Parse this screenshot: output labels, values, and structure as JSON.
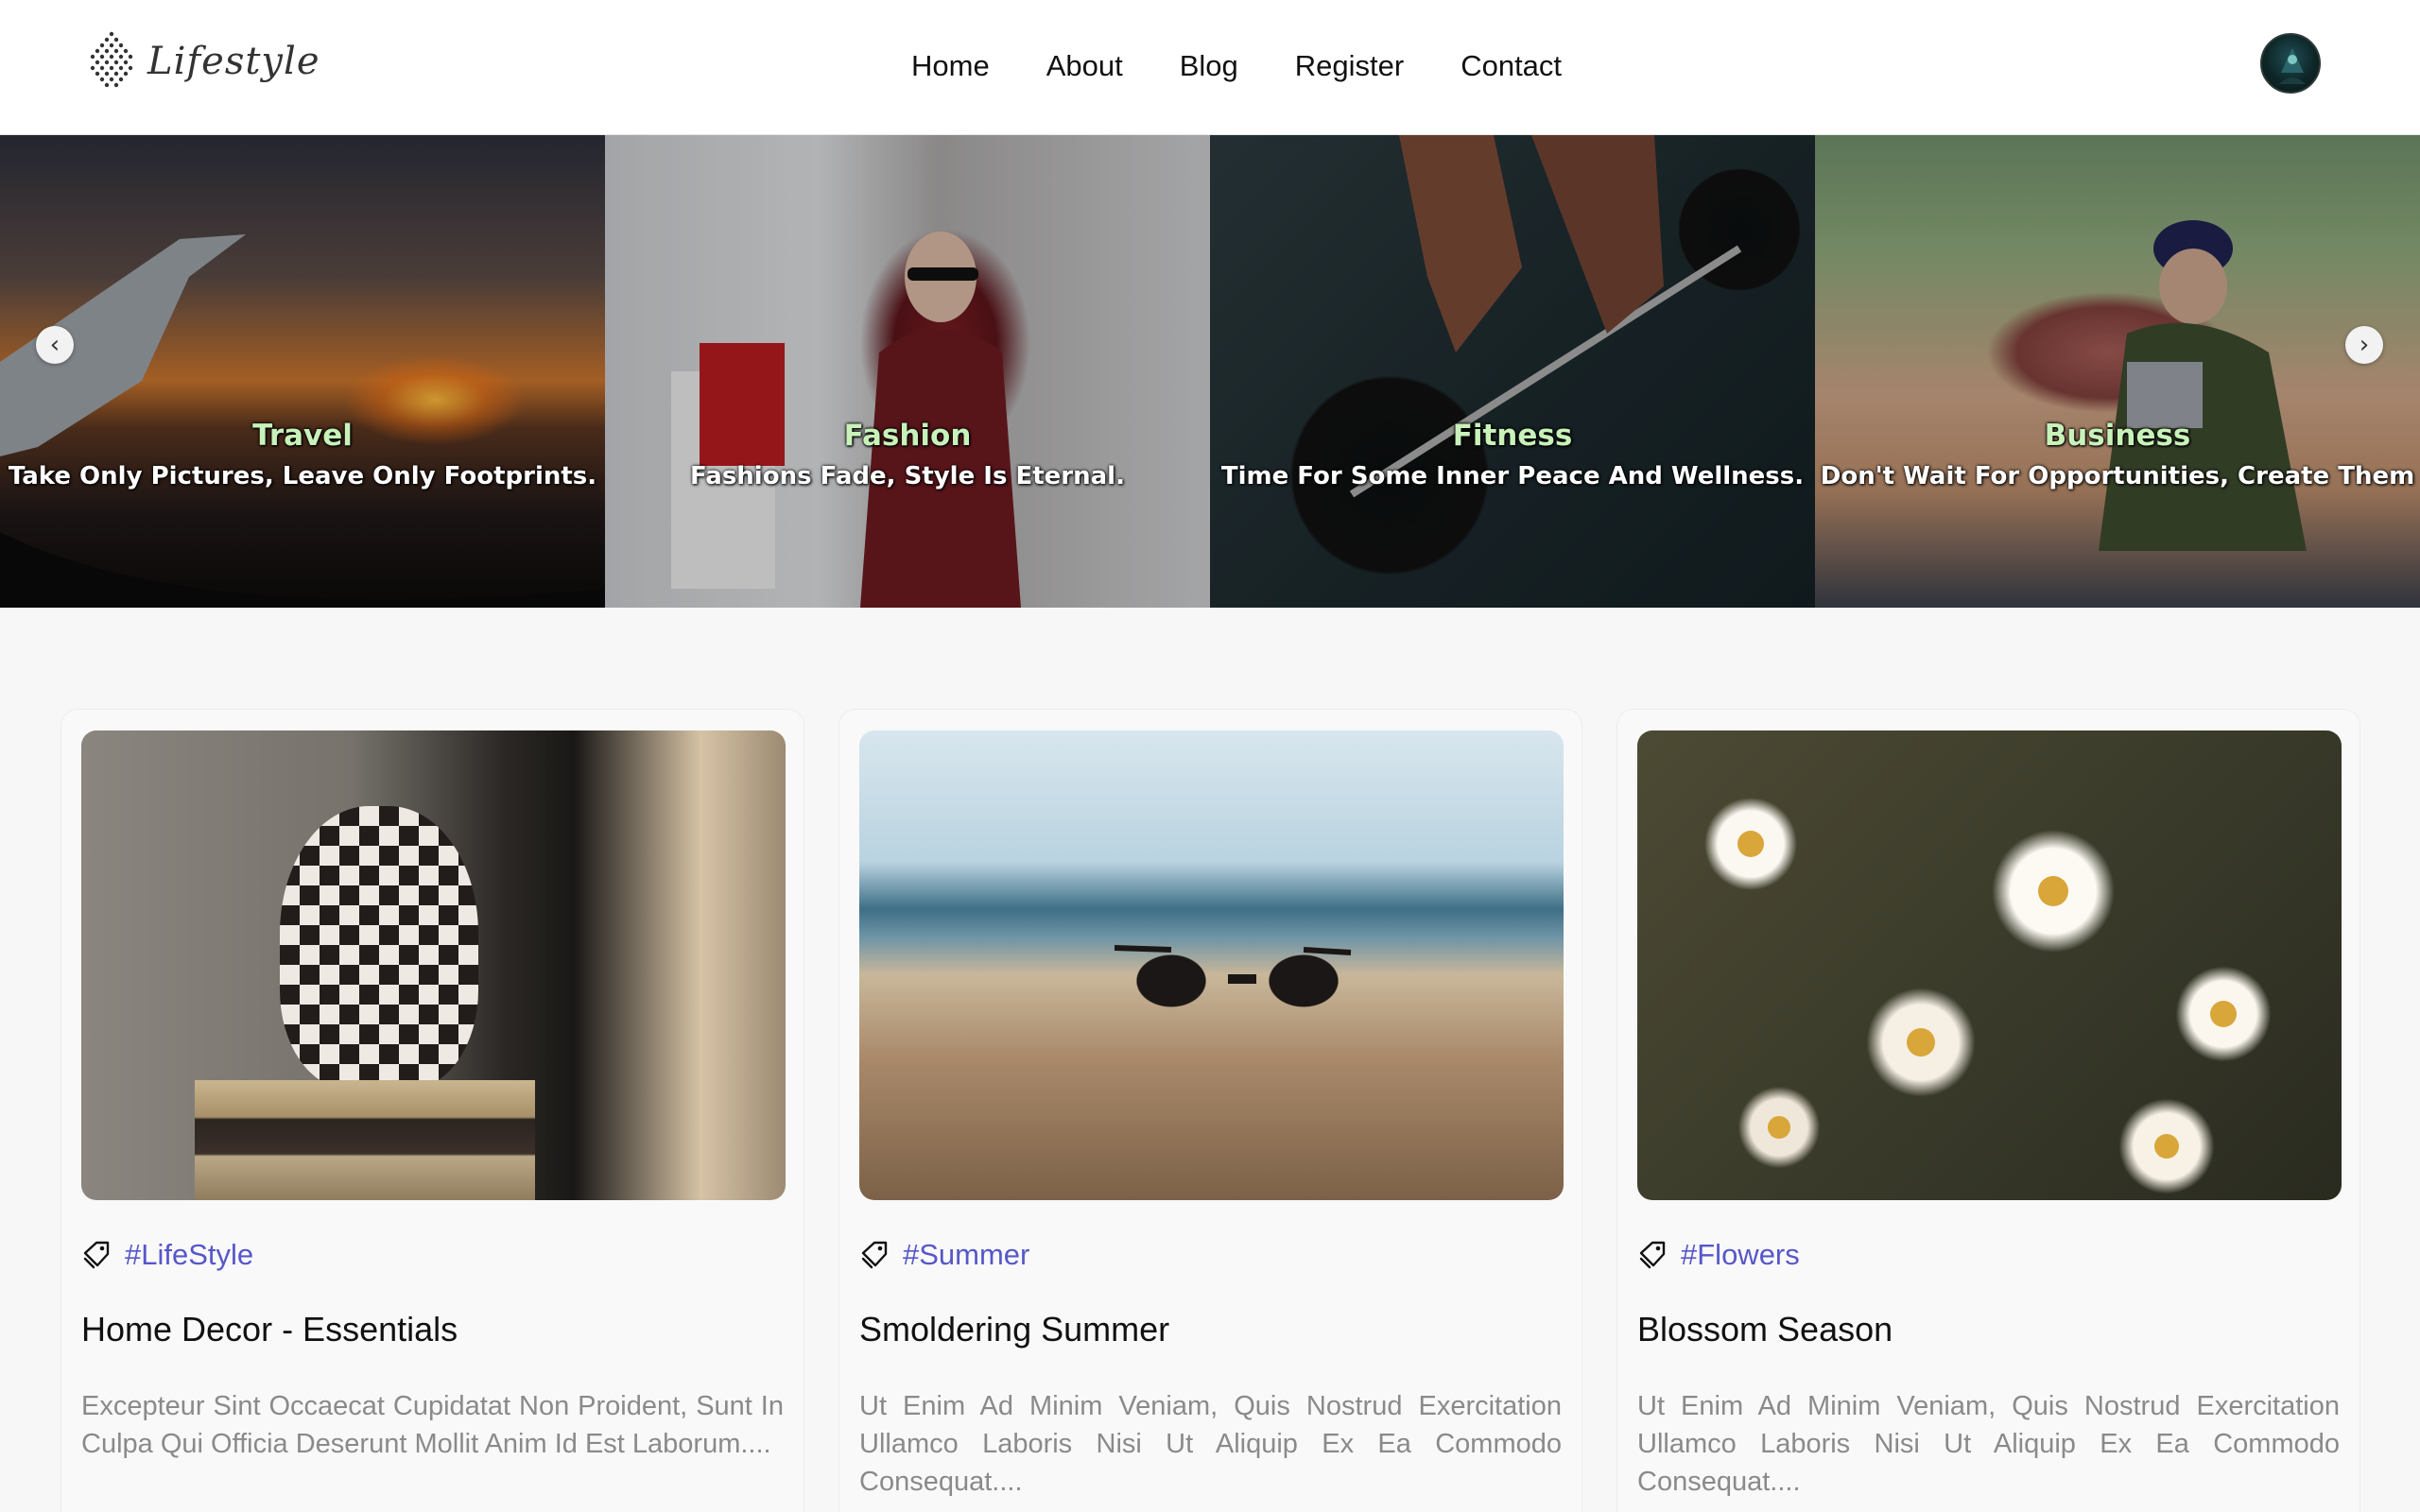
{
  "header": {
    "logo_text": "Lifestyle",
    "nav": [
      "Home",
      "About",
      "Blog",
      "Register",
      "Contact"
    ]
  },
  "carousel": {
    "slides": [
      {
        "title": "Travel",
        "subtitle": "Take Only Pictures, Leave Only Footprints."
      },
      {
        "title": "Fashion",
        "subtitle": "Fashions Fade, Style Is Eternal."
      },
      {
        "title": "Fitness",
        "subtitle": "Time For Some Inner Peace And Wellness."
      },
      {
        "title": "Business",
        "subtitle": "Don't Wait For Opportunities, Create Them"
      }
    ],
    "prev_glyph": "‹",
    "next_glyph": "›"
  },
  "cards": [
    {
      "tag": "#LifeStyle",
      "title": "Home Decor - Essentials",
      "text": "Excepteur Sint Occaecat Cupidatat Non Proident, Sunt In Culpa Qui Officia Deserunt Mollit Anim Id Est Laborum...."
    },
    {
      "tag": "#Summer",
      "title": "Smoldering Summer",
      "text": "Ut Enim Ad Minim Veniam, Quis Nostrud Exercitation Ullamco Laboris Nisi Ut Aliquip Ex Ea Commodo Consequat...."
    },
    {
      "tag": "#Flowers",
      "title": "Blossom Season",
      "text": "Ut Enim Ad Minim Veniam, Quis Nostrud Exercitation Ullamco Laboris Nisi Ut Aliquip Ex Ea Commodo Consequat...."
    }
  ],
  "colors": {
    "tag": "#5757c9",
    "caption_title": "#c8f2b9"
  },
  "icons": {
    "logo": "diamond-dots-logo-icon",
    "tag": "tag-icon",
    "prev": "chevron-left-icon",
    "next": "chevron-right-icon"
  }
}
